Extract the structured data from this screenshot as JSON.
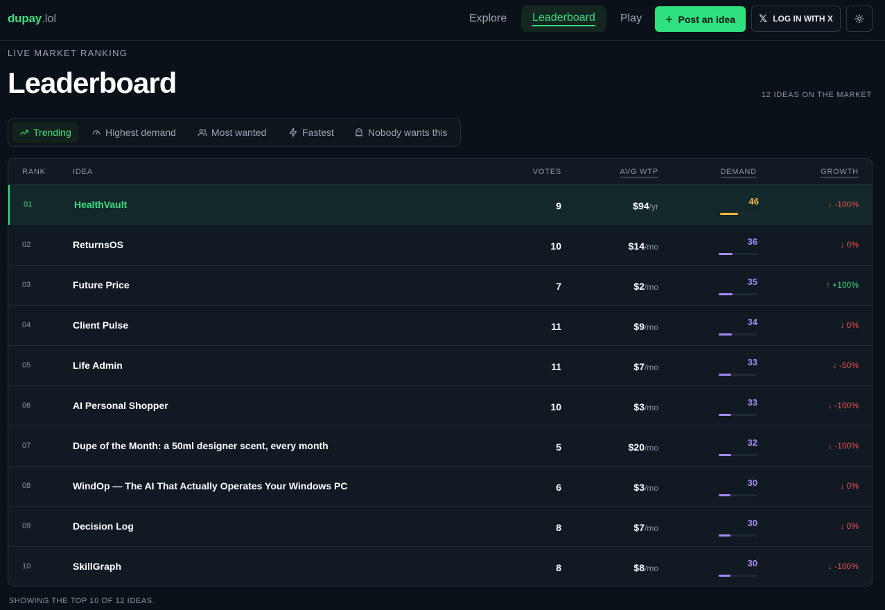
{
  "brand": {
    "name": "dupay",
    "tld": ".lol"
  },
  "nav": {
    "explore": "Explore",
    "leaderboard": "Leaderboard",
    "play": "Play",
    "post_label": "Post an idea",
    "login_label": "LOG IN WITH X"
  },
  "header": {
    "kicker": "LIVE MARKET RANKING",
    "title": "Leaderboard",
    "count": "12 IDEAS ON THE MARKET"
  },
  "tabs": [
    "Trending",
    "Highest demand",
    "Most wanted",
    "Fastest",
    "Nobody wants this"
  ],
  "table": {
    "columns": {
      "rank": "RANK",
      "idea": "IDEA",
      "votes": "VOTES",
      "wtp": "AVG WTP",
      "demand": "DEMAND",
      "growth": "GROWTH"
    },
    "rows": [
      {
        "rank": "01",
        "idea": "HealthVault",
        "votes": "9",
        "wtp": "$94",
        "per": "/yr",
        "demand": "46",
        "demand_level": 0.46,
        "growth": "-100%",
        "dir": "down"
      },
      {
        "rank": "02",
        "idea": "ReturnsOS",
        "votes": "10",
        "wtp": "$14",
        "per": "/mo",
        "demand": "36",
        "demand_level": 0.36,
        "growth": "0%",
        "dir": "down"
      },
      {
        "rank": "03",
        "idea": "Future Price",
        "votes": "7",
        "wtp": "$2",
        "per": "/mo",
        "demand": "35",
        "demand_level": 0.35,
        "growth": "+100%",
        "dir": "up"
      },
      {
        "rank": "04",
        "idea": "Client Pulse",
        "votes": "11",
        "wtp": "$9",
        "per": "/mo",
        "demand": "34",
        "demand_level": 0.34,
        "growth": "0%",
        "dir": "down"
      },
      {
        "rank": "05",
        "idea": "Life Admin",
        "votes": "11",
        "wtp": "$7",
        "per": "/mo",
        "demand": "33",
        "demand_level": 0.33,
        "growth": "-50%",
        "dir": "down"
      },
      {
        "rank": "06",
        "idea": "AI Personal Shopper",
        "votes": "10",
        "wtp": "$3",
        "per": "/mo",
        "demand": "33",
        "demand_level": 0.33,
        "growth": "-100%",
        "dir": "down"
      },
      {
        "rank": "07",
        "idea": "Dupe of the Month: a 50ml designer scent, every month",
        "votes": "5",
        "wtp": "$20",
        "per": "/mo",
        "demand": "32",
        "demand_level": 0.32,
        "growth": "-100%",
        "dir": "down"
      },
      {
        "rank": "08",
        "idea": "WindOp — The AI That Actually Operates Your Windows PC",
        "votes": "6",
        "wtp": "$3",
        "per": "/mo",
        "demand": "30",
        "demand_level": 0.3,
        "growth": "0%",
        "dir": "down"
      },
      {
        "rank": "09",
        "idea": "Decision Log",
        "votes": "8",
        "wtp": "$7",
        "per": "/mo",
        "demand": "30",
        "demand_level": 0.3,
        "growth": "0%",
        "dir": "down"
      },
      {
        "rank": "10",
        "idea": "SkillGraph",
        "votes": "8",
        "wtp": "$8",
        "per": "/mo",
        "demand": "30",
        "demand_level": 0.3,
        "growth": "-100%",
        "dir": "down"
      }
    ]
  },
  "footer": "SHOWING THE TOP 10 OF 12 IDEAS.",
  "colors": {
    "accent": "#3ddc84",
    "demand_top": "#f6b73c",
    "demand": "#a78bfa",
    "down": "#ef5350",
    "up": "#3ddc84"
  }
}
